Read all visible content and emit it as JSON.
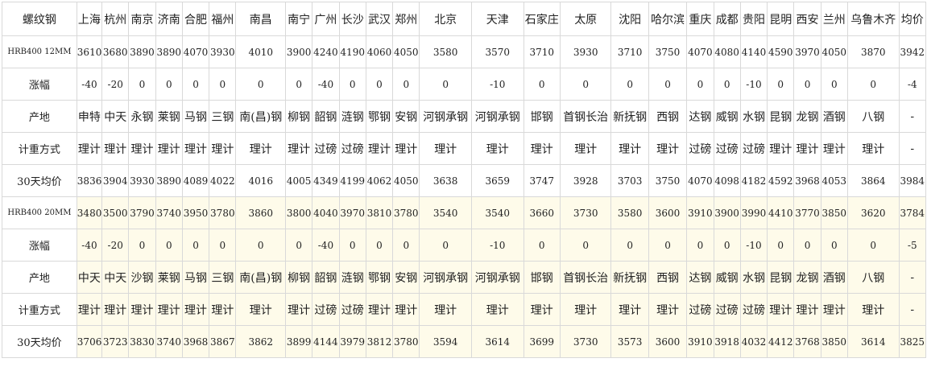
{
  "columns": [
    "螺纹钢",
    "上海",
    "杭州",
    "南京",
    "济南",
    "合肥",
    "福州",
    "南昌",
    "南宁",
    "广州",
    "长沙",
    "武汉",
    "郑州",
    "北京",
    "天津",
    "石家庄",
    "太原",
    "沈阳",
    "哈尔滨",
    "重庆",
    "成都",
    "贵阳",
    "昆明",
    "西安",
    "兰州",
    "乌鲁木齐",
    "均价"
  ],
  "rows": [
    {
      "label": "HRB400 12MM",
      "kind": "spec",
      "alt": false,
      "cells": [
        "3610",
        "3680",
        "3890",
        "3890",
        "4070",
        "3930",
        "4010",
        "3900",
        "4240",
        "4190",
        "4060",
        "4050",
        "3580",
        "3570",
        "3710",
        "3930",
        "3710",
        "3750",
        "4070",
        "4080",
        "4140",
        "4590",
        "3970",
        "4050",
        "3870",
        "3942"
      ]
    },
    {
      "label": "涨幅",
      "kind": "label",
      "alt": false,
      "cells": [
        "-40",
        "-20",
        "0",
        "0",
        "0",
        "0",
        "0",
        "0",
        "-40",
        "0",
        "0",
        "0",
        "0",
        "-10",
        "0",
        "0",
        "0",
        "0",
        "0",
        "0",
        "-10",
        "0",
        "0",
        "0",
        "0",
        "-4"
      ]
    },
    {
      "label": "产地",
      "kind": "label",
      "alt": false,
      "cjk": true,
      "cells": [
        "申特",
        "中天",
        "永钢",
        "莱钢",
        "马钢",
        "三钢",
        "南(昌)钢",
        "柳钢",
        "韶钢",
        "涟钢",
        "鄂钢",
        "安钢",
        "河钢承钢",
        "河钢承钢",
        "邯钢",
        "首钢长治",
        "新抚钢",
        "西钢",
        "达钢",
        "威钢",
        "水钢",
        "昆钢",
        "龙钢",
        "酒钢",
        "八钢",
        "-"
      ]
    },
    {
      "label": "计重方式",
      "kind": "label",
      "alt": false,
      "cjk": true,
      "cells": [
        "理计",
        "理计",
        "理计",
        "理计",
        "理计",
        "理计",
        "理计",
        "理计",
        "过磅",
        "过磅",
        "理计",
        "理计",
        "理计",
        "理计",
        "理计",
        "理计",
        "理计",
        "理计",
        "过磅",
        "过磅",
        "过磅",
        "理计",
        "理计",
        "理计",
        "理计",
        "-"
      ]
    },
    {
      "label": "30天均价",
      "kind": "label",
      "alt": false,
      "cells": [
        "3836",
        "3904",
        "3930",
        "3890",
        "4089",
        "4022",
        "4016",
        "4005",
        "4349",
        "4199",
        "4062",
        "4050",
        "3638",
        "3659",
        "3747",
        "3928",
        "3703",
        "3750",
        "4070",
        "4098",
        "4182",
        "4592",
        "3968",
        "4053",
        "3864",
        "3984"
      ]
    },
    {
      "label": "HRB400 20MM",
      "kind": "spec",
      "alt": true,
      "cells": [
        "3480",
        "3500",
        "3790",
        "3740",
        "3950",
        "3780",
        "3860",
        "3800",
        "4040",
        "3970",
        "3810",
        "3780",
        "3540",
        "3540",
        "3660",
        "3730",
        "3580",
        "3600",
        "3910",
        "3900",
        "3990",
        "4410",
        "3770",
        "3850",
        "3620",
        "3784"
      ]
    },
    {
      "label": "涨幅",
      "kind": "label",
      "alt": true,
      "cells": [
        "-40",
        "-20",
        "0",
        "0",
        "0",
        "0",
        "0",
        "0",
        "-40",
        "0",
        "0",
        "0",
        "0",
        "-10",
        "0",
        "0",
        "0",
        "0",
        "0",
        "0",
        "-10",
        "0",
        "0",
        "0",
        "0",
        "-5"
      ]
    },
    {
      "label": "产地",
      "kind": "label",
      "alt": true,
      "cjk": true,
      "cells": [
        "中天",
        "中天",
        "沙钢",
        "莱钢",
        "马钢",
        "三钢",
        "南(昌)钢",
        "柳钢",
        "韶钢",
        "涟钢",
        "鄂钢",
        "安钢",
        "河钢承钢",
        "河钢承钢",
        "邯钢",
        "首钢长治",
        "新抚钢",
        "西钢",
        "达钢",
        "威钢",
        "水钢",
        "昆钢",
        "龙钢",
        "酒钢",
        "八钢",
        "-"
      ]
    },
    {
      "label": "计重方式",
      "kind": "label",
      "alt": true,
      "cjk": true,
      "cells": [
        "理计",
        "理计",
        "理计",
        "理计",
        "理计",
        "理计",
        "理计",
        "理计",
        "过磅",
        "过磅",
        "理计",
        "理计",
        "理计",
        "理计",
        "理计",
        "理计",
        "理计",
        "理计",
        "过磅",
        "过磅",
        "过磅",
        "理计",
        "理计",
        "理计",
        "理计",
        "-"
      ]
    },
    {
      "label": "30天均价",
      "kind": "label",
      "alt": true,
      "cells": [
        "3706",
        "3723",
        "3830",
        "3740",
        "3968",
        "3867",
        "3862",
        "3899",
        "4144",
        "3979",
        "3812",
        "3780",
        "3594",
        "3614",
        "3699",
        "3730",
        "3573",
        "3600",
        "3910",
        "3918",
        "4032",
        "4412",
        "3768",
        "3850",
        "3614",
        "3825"
      ]
    }
  ]
}
